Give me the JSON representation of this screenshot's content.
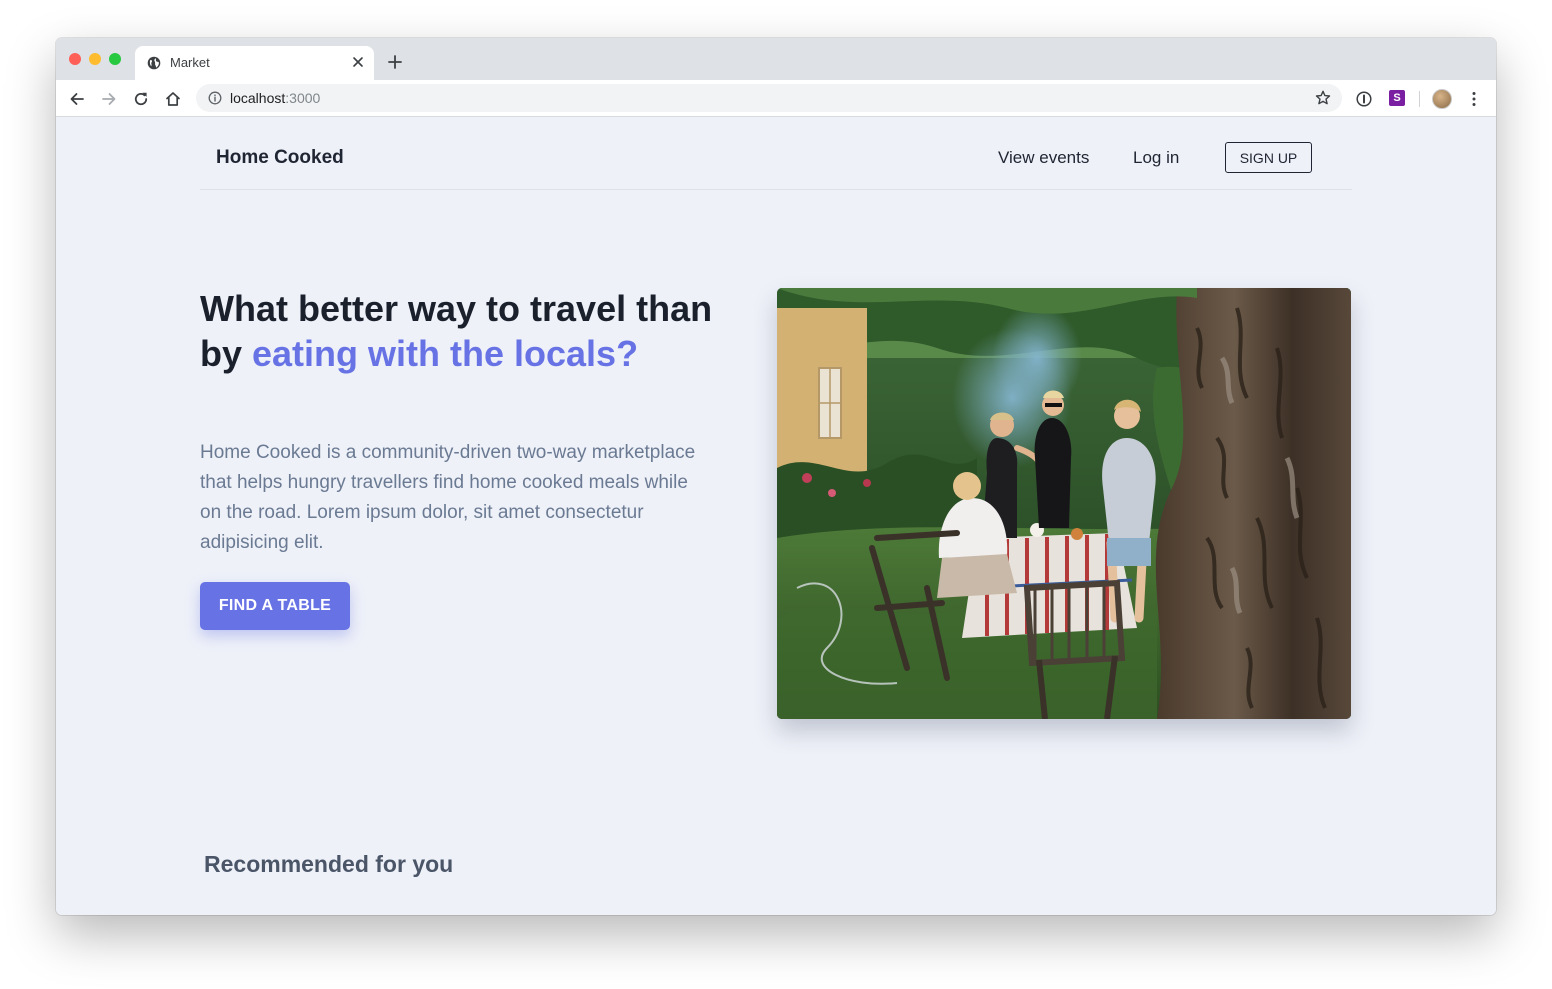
{
  "browser": {
    "tab_title": "Market",
    "url_host": "localhost",
    "url_port": ":3000",
    "extension_badge": "S"
  },
  "nav": {
    "brand": "Home Cooked",
    "view_events": "View events",
    "log_in": "Log in",
    "sign_up": "SIGN UP"
  },
  "hero": {
    "title_plain": "What better way to travel than by ",
    "title_accent": "eating with the locals?",
    "description": "Home Cooked is a community-driven two-way marketplace that helps hungry travellers find home cooked meals while on the road. Lorem ipsum dolor, sit amet consectetur adipisicing elit.",
    "cta_label": "FIND A TABLE"
  },
  "recommended": {
    "title": "Recommended for you"
  },
  "colors": {
    "accent": "#6772e5",
    "page_bg": "#eef1f8",
    "heading": "#1a202c",
    "body_text": "#6b7a93"
  }
}
